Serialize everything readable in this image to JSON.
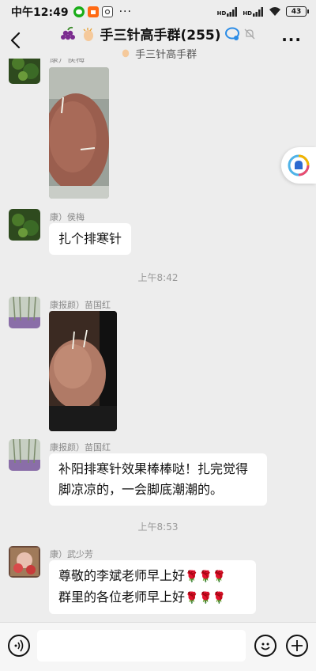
{
  "status": {
    "time": "中午12:49",
    "more": "···",
    "signal1": "HD",
    "signal2": "HD",
    "battery": "43"
  },
  "header": {
    "title": "手三针高手群(255)",
    "subtitle": "手三针高手群",
    "more": "···"
  },
  "messages": [
    {
      "sender": "康）侯梅"
    },
    {
      "sender": "康）侯梅",
      "text": "扎个排寒针"
    },
    {
      "time": "上午8:42"
    },
    {
      "sender": "康报颜）苗国红"
    },
    {
      "sender": "康报颜）苗国红",
      "line1": "补阳排寒针效果棒棒哒！扎完觉得",
      "line2": "脚凉凉的，一会脚底潮潮的。"
    },
    {
      "time": "上午8:53"
    },
    {
      "sender": "康）武少芳",
      "line1": "尊敬的李斌老师早上好",
      "line2": "群里的各位老师早上好",
      "roses": "🌹🌹🌹"
    }
  ],
  "input": {
    "placeholder": ""
  },
  "colors": {
    "background": "#ededed",
    "bubble": "#ffffff",
    "accent": "#1aad19"
  },
  "icons": [
    "back-icon",
    "grapes-icon",
    "clap-icon",
    "chat-bubble-icon",
    "mute-bell-icon",
    "voice-icon",
    "emoji-icon",
    "plus-icon"
  ]
}
